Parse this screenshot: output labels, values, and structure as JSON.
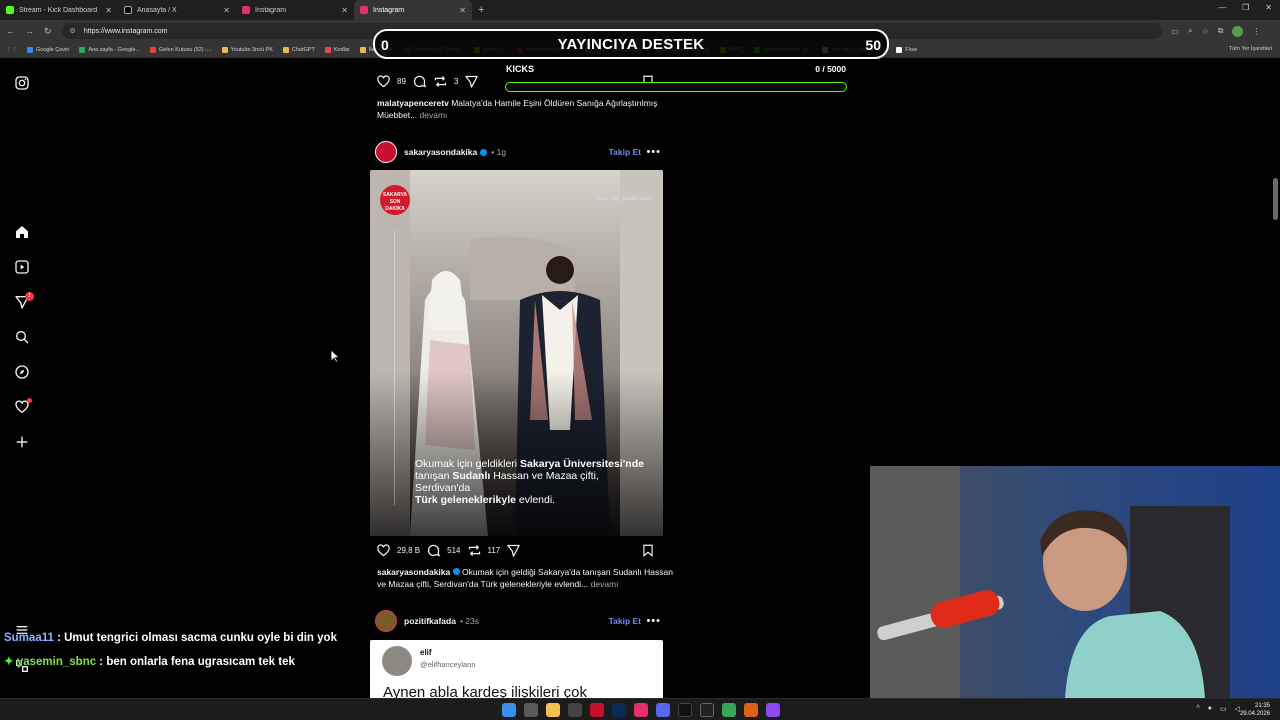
{
  "browser": {
    "tabs": [
      {
        "title": "Stream - Kick Dashboard",
        "color": "#53fc18"
      },
      {
        "title": "Anasayfa / X",
        "color": "#ffffff"
      },
      {
        "title": "Instagram",
        "color": "#e1306c"
      },
      {
        "title": "Instagram",
        "color": "#e1306c"
      }
    ],
    "url": "https://www.instagram.com",
    "bookmarks": [
      {
        "label": "Google Çeviri",
        "color": "#4285f4"
      },
      {
        "label": "Ana sayfa - Google...",
        "color": "#34a853"
      },
      {
        "label": "Gelen Kutusu (52) -...",
        "color": "#ea4335"
      },
      {
        "label": "Youtube 3ncü PK",
        "color": "#e8b84a"
      },
      {
        "label": "ChatGPT",
        "color": "#e8b84a"
      },
      {
        "label": "Kodlar",
        "color": "#e84a4a"
      },
      {
        "label": "İleş Örnek",
        "color": "#e8b84a"
      },
      {
        "label": "Transcript of \"Mr M...",
        "color": "#c24a4a"
      },
      {
        "label": "türkçe h...",
        "color": "#e8b84a"
      },
      {
        "label": "YouTube Keyword...",
        "color": "#e84a4a"
      },
      {
        "label": "Hangi tebrik mesajı...",
        "color": "#888888"
      },
      {
        "label": "HeyGen - Projects",
        "color": "#6b6bff"
      },
      {
        "label": "BURÇ",
        "color": "#e8b84a"
      },
      {
        "label": "Esperanzalibre 3d...",
        "color": "#53fc18"
      },
      {
        "label": "The best ChatBot an...",
        "color": "#ffffff"
      },
      {
        "label": "Flow",
        "color": "#ffffff"
      }
    ],
    "bookmarks_right": "Tüm Yer İşaretleri"
  },
  "overlay": {
    "donation_left": "0",
    "donation_title": "YAYINCIYA DESTEK",
    "donation_right": "50",
    "kicks_label": "KICKS",
    "kicks_count": "0 / 5000",
    "kicks_progress": 0
  },
  "feed": {
    "prev_post": {
      "likes": "89",
      "reposts": "3",
      "caption_user": "malatyapenceretv",
      "caption_text": "Malatya'da Hamile Eşini Öldüren Sanığa Ağırlaştırılmış Müebbet...",
      "more": "devamı"
    },
    "post1": {
      "user": "sakaryasondakika",
      "time": "• 1g",
      "follow": "Takip Et",
      "more_dots": "•••",
      "photo_caption_1": "Okumak için geldikleri ",
      "photo_caption_2": "Sakarya Üniversitesi'nde",
      "photo_caption_3": "tanışan ",
      "photo_caption_4": "Sudanlı",
      "photo_caption_5": " Hassan ve Mazaa çifti, Serdivan'da",
      "photo_caption_6": "Türk geleneklerikyle",
      "photo_caption_7": " evlendi.",
      "logo_text": "SAKARYA SON DAKİKA",
      "photo_tag": "hızlı, hızlı, gerçek haber",
      "likes": "29,8 B",
      "comments": "514",
      "reposts": "117",
      "caption_user": "sakaryasondakika",
      "caption_text": "Okumak için geldiği Sakarya'da tanışan Sudanlı Hassan ve Mazaa çifti, Serdivan'da Türk gelenekleriyle evlendi...",
      "more": "devamı"
    },
    "post2": {
      "user": "pozitifkafada",
      "time": "• 23s",
      "follow": "Takip Et",
      "more_dots": "•••",
      "tweet_name": "elif",
      "tweet_handle": "@elifhanceylann",
      "tweet_text": "Aynen abla kardeş ilişkileri çok"
    }
  },
  "chat": [
    {
      "user": "Sumaa11",
      "message": " : Umut tengrici olması sacma cunku oyle bi din yok"
    },
    {
      "user": "yasemin_sbnc",
      "message": " : ben onlarla fena ugrasıcam tek tek"
    }
  ],
  "sidebar": {
    "notifications_badge": "1"
  },
  "taskbar": {
    "time": "21:35",
    "date": "29.04.2026"
  }
}
